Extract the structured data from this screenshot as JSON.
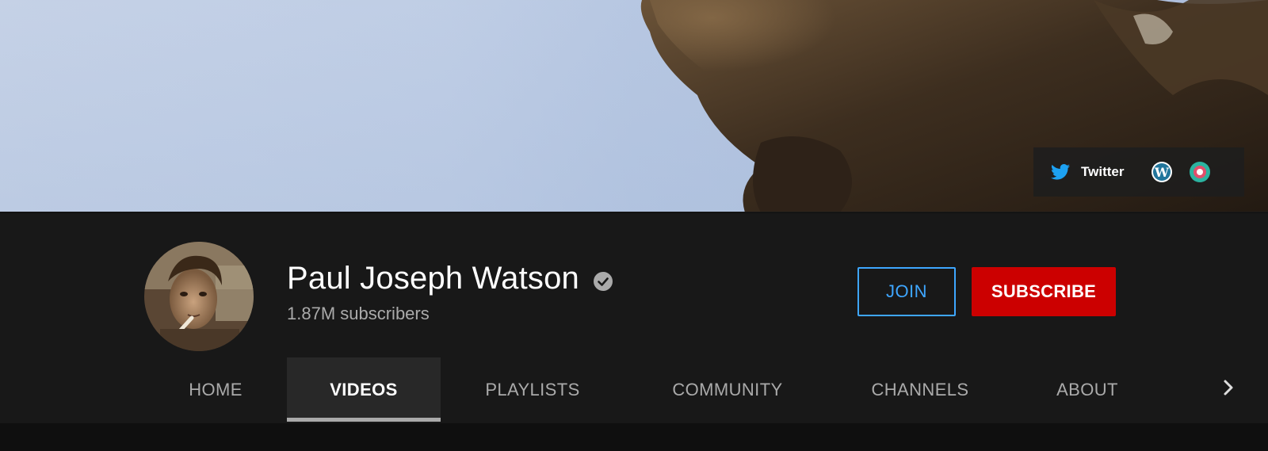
{
  "banner": {
    "links": [
      {
        "label": "Twitter",
        "icon": "twitter-icon",
        "color": "#1da1f2"
      },
      {
        "label": "",
        "icon": "wordpress-icon",
        "color": "#ffffff"
      },
      {
        "label": "",
        "icon": "bitchute-icon",
        "color": "#e24e6b"
      }
    ]
  },
  "channel": {
    "name": "Paul Joseph Watson",
    "verified_icon": "check-circle-icon",
    "subscribers": "1.87M subscribers"
  },
  "actions": {
    "join_label": "JOIN",
    "subscribe_label": "SUBSCRIBE",
    "join_color": "#3ea6ff",
    "subscribe_color": "#cc0000"
  },
  "tabs": [
    {
      "label": "HOME",
      "active": false
    },
    {
      "label": "VIDEOS",
      "active": true
    },
    {
      "label": "PLAYLISTS",
      "active": false
    },
    {
      "label": "COMMUNITY",
      "active": false
    },
    {
      "label": "CHANNELS",
      "active": false
    },
    {
      "label": "ABOUT",
      "active": false
    }
  ],
  "tabs_next_icon": "chevron-right-icon"
}
